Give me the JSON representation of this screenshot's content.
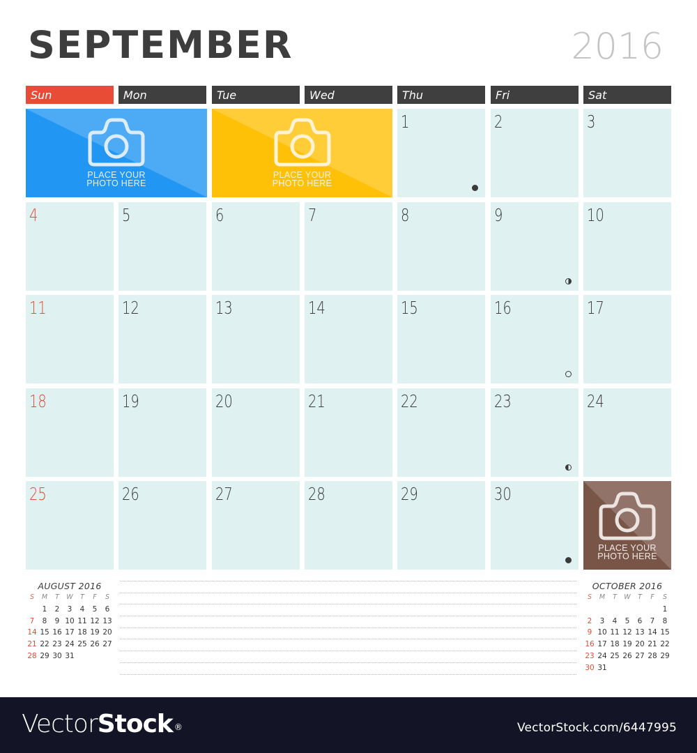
{
  "header": {
    "month": "SEPTEMBER",
    "year": "2016"
  },
  "weekdays": [
    "Sun",
    "Mon",
    "Tue",
    "Wed",
    "Thu",
    "Fri",
    "Sat"
  ],
  "colors": {
    "sunday_header": "#e84c36",
    "weekday_header": "#3f3f3f",
    "cell_background": "#e0f1f1",
    "sunday_number": "#e04c36",
    "photo_blue": "#2196f3",
    "photo_yellow": "#ffc107",
    "photo_brown": "#795548"
  },
  "photo_placeholders": [
    {
      "label_line1": "PLACE YOUR",
      "label_line2": "PHOTO HERE",
      "color": "blue",
      "position": "week 1, Sun–Mon"
    },
    {
      "label_line1": "PLACE YOUR",
      "label_line2": "PHOTO HERE",
      "color": "yellow",
      "position": "week 1, Tue–Wed"
    },
    {
      "label_line1": "PLACE YOUR",
      "label_line2": "PHOTO HERE",
      "color": "brown",
      "position": "week 5, Sat"
    }
  ],
  "days": [
    {
      "n": "1",
      "dow": 4,
      "moon": "new"
    },
    {
      "n": "2",
      "dow": 5
    },
    {
      "n": "3",
      "dow": 6
    },
    {
      "n": "4",
      "dow": 0
    },
    {
      "n": "5",
      "dow": 1
    },
    {
      "n": "6",
      "dow": 2
    },
    {
      "n": "7",
      "dow": 3
    },
    {
      "n": "8",
      "dow": 4
    },
    {
      "n": "9",
      "dow": 5,
      "moon": "first-quarter"
    },
    {
      "n": "10",
      "dow": 6
    },
    {
      "n": "11",
      "dow": 0
    },
    {
      "n": "12",
      "dow": 1
    },
    {
      "n": "13",
      "dow": 2
    },
    {
      "n": "14",
      "dow": 3
    },
    {
      "n": "15",
      "dow": 4
    },
    {
      "n": "16",
      "dow": 5,
      "moon": "full"
    },
    {
      "n": "17",
      "dow": 6
    },
    {
      "n": "18",
      "dow": 0
    },
    {
      "n": "19",
      "dow": 1
    },
    {
      "n": "20",
      "dow": 2
    },
    {
      "n": "21",
      "dow": 3
    },
    {
      "n": "22",
      "dow": 4
    },
    {
      "n": "23",
      "dow": 5,
      "moon": "last-quarter"
    },
    {
      "n": "24",
      "dow": 6
    },
    {
      "n": "25",
      "dow": 0
    },
    {
      "n": "26",
      "dow": 1
    },
    {
      "n": "27",
      "dow": 2
    },
    {
      "n": "28",
      "dow": 3
    },
    {
      "n": "29",
      "dow": 4
    },
    {
      "n": "30",
      "dow": 5,
      "moon": "new"
    }
  ],
  "mini_calendars": [
    {
      "title": "AUGUST 2016",
      "weekday_initials": [
        "S",
        "M",
        "T",
        "W",
        "T",
        "F",
        "S"
      ],
      "first_dow": 1,
      "days": [
        "1",
        "2",
        "3",
        "4",
        "5",
        "6",
        "7",
        "8",
        "9",
        "10",
        "11",
        "12",
        "13",
        "14",
        "15",
        "16",
        "17",
        "18",
        "19",
        "20",
        "21",
        "22",
        "23",
        "24",
        "25",
        "26",
        "27",
        "28",
        "29",
        "30",
        "31"
      ]
    },
    {
      "title": "OCTOBER 2016",
      "weekday_initials": [
        "S",
        "M",
        "T",
        "W",
        "T",
        "F",
        "S"
      ],
      "first_dow": 6,
      "days": [
        "1",
        "2",
        "3",
        "4",
        "5",
        "6",
        "7",
        "8",
        "9",
        "10",
        "11",
        "12",
        "13",
        "14",
        "15",
        "16",
        "17",
        "18",
        "19",
        "20",
        "21",
        "22",
        "23",
        "24",
        "25",
        "26",
        "27",
        "28",
        "29",
        "30",
        "31"
      ]
    }
  ],
  "notes": {
    "line_count": 9
  },
  "footer": {
    "brand_light": "Vector",
    "brand_bold": "Stock",
    "brand_mark": "®",
    "url": "VectorStock.com/6447995"
  }
}
